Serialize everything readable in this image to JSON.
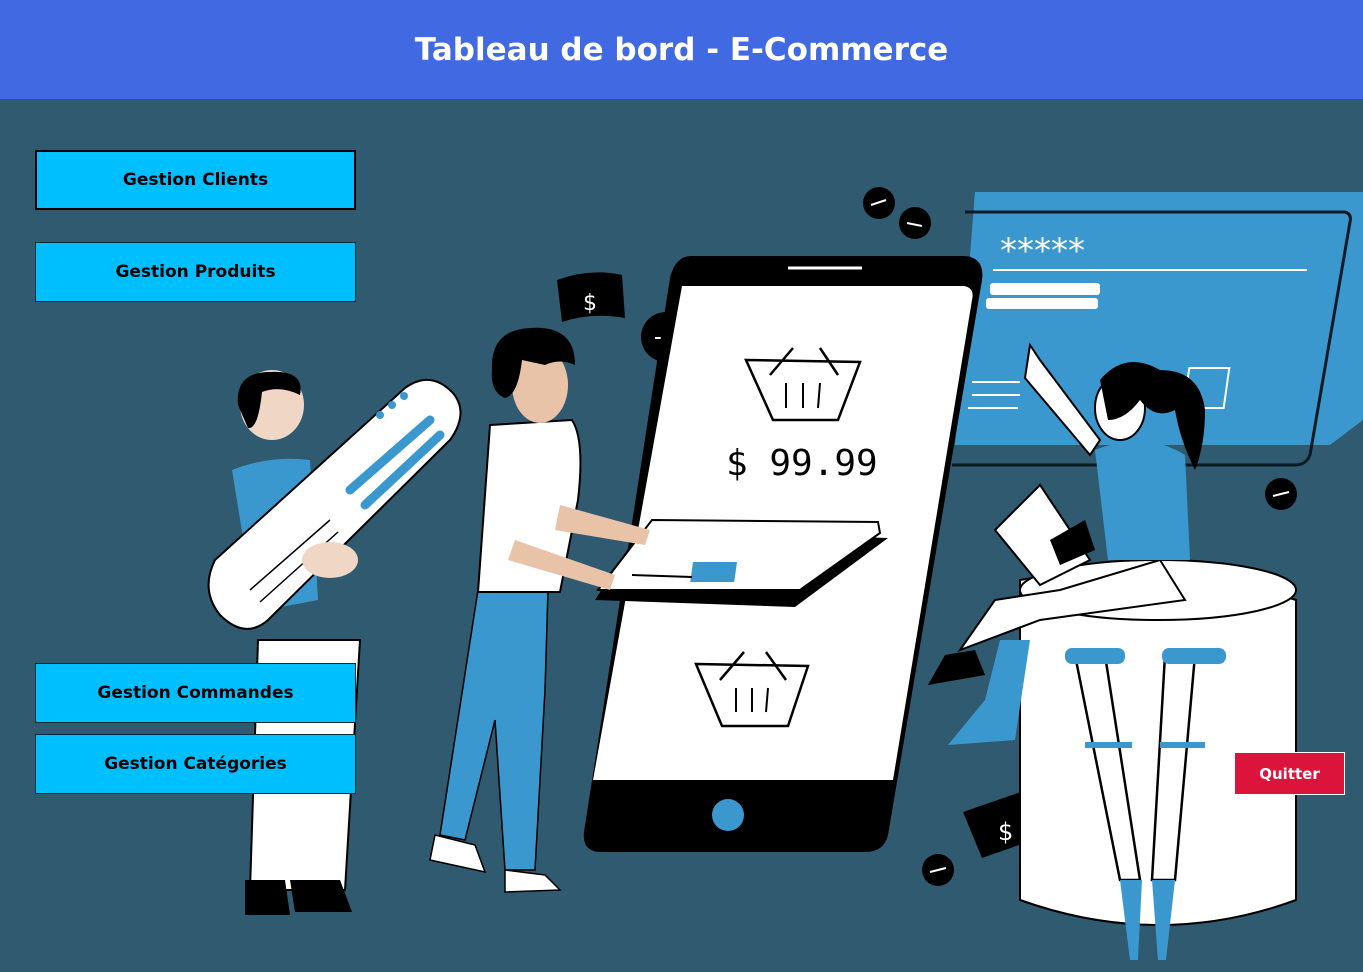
{
  "header": {
    "title": "Tableau de bord - E-Commerce"
  },
  "nav": {
    "clients_label": "Gestion Clients",
    "produits_label": "Gestion Produits",
    "commandes_label": "Gestion Commandes",
    "categories_label": "Gestion Catégories"
  },
  "quit_label": "Quitter",
  "illustration": {
    "price_text": "$ 99.99",
    "password_mask": "*****",
    "dollar_sign": "$"
  },
  "colors": {
    "header": "#4169e1",
    "background": "#2f5a70",
    "nav_button": "#00bfff",
    "quit_button": "#dc143c",
    "accent": "#3b98cf"
  }
}
